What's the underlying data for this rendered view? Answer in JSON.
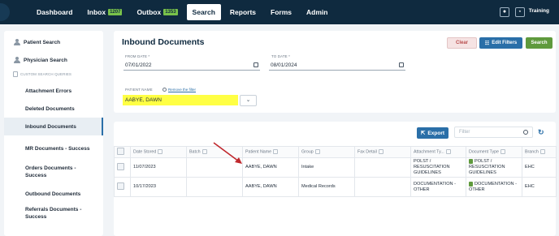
{
  "nav": {
    "dashboard": "Dashboard",
    "inbox": "Inbox",
    "inbox_count": "1207",
    "outbox": "Outbox",
    "outbox_count": "1353",
    "search": "Search",
    "reports": "Reports",
    "forms": "Forms",
    "admin": "Admin",
    "training": "Training",
    "icons": [
      "lock-icon",
      "network-icon"
    ]
  },
  "sidebar": {
    "patient_search": "Patient Search",
    "physician_search": "Physician Search",
    "custom_heading": "CUSTOM SEARCH QUERIES",
    "items": [
      "Attachment Errors",
      "Deleted Documents",
      "Inbound Documents",
      "MR Documents - Success",
      "Orders Documents - Success",
      "Outbound Documents",
      "Referrals Documents - Success"
    ],
    "active_item": "Inbound Documents"
  },
  "filters": {
    "title": "Inbound Documents",
    "clear": "Clear",
    "edit_filters": "Edit Filters",
    "search": "Search",
    "from_label": "FROM DATE *",
    "from_value": "07/01/2022",
    "to_label": "TO DATE *",
    "to_value": "08/01/2024",
    "patient_label": "PATIENT NAME",
    "remove_filter": "Remove the filter",
    "patient_value": "AABYE, DAWN"
  },
  "results": {
    "export": "Export",
    "filter_placeholder": "Filter",
    "columns": [
      "Date Stored",
      "Batch",
      "Patient Name",
      "Group",
      "Fax Detail",
      "Attachment Ty...",
      "Document Type",
      "Branch"
    ],
    "rows": [
      {
        "date": "11/07/2023",
        "batch": "",
        "patient": "AABYE, DAWN",
        "group": "Intake",
        "fax": "",
        "attachment": [
          "POLST /",
          "RESUSCITATION",
          "GUIDELINES"
        ],
        "doc_type": [
          "POLST /",
          "RESUSCITATION",
          "GUIDELINES"
        ],
        "branch": "EHC"
      },
      {
        "date": "10/17/2023",
        "batch": "",
        "patient": "AABYE, DAWN",
        "group": "Medical Records",
        "fax": "",
        "attachment": [
          "DOCUMENTATION -",
          "OTHER"
        ],
        "doc_type": [
          "DOCUMENTATION -",
          "OTHER"
        ],
        "branch": "EHC"
      }
    ]
  },
  "colors": {
    "nav_bg": "#0f2a3f",
    "primary": "#2a6fa8",
    "success": "#5f9a3d",
    "highlight": "#ffff44",
    "annotation_arrow": "#c0282d"
  }
}
